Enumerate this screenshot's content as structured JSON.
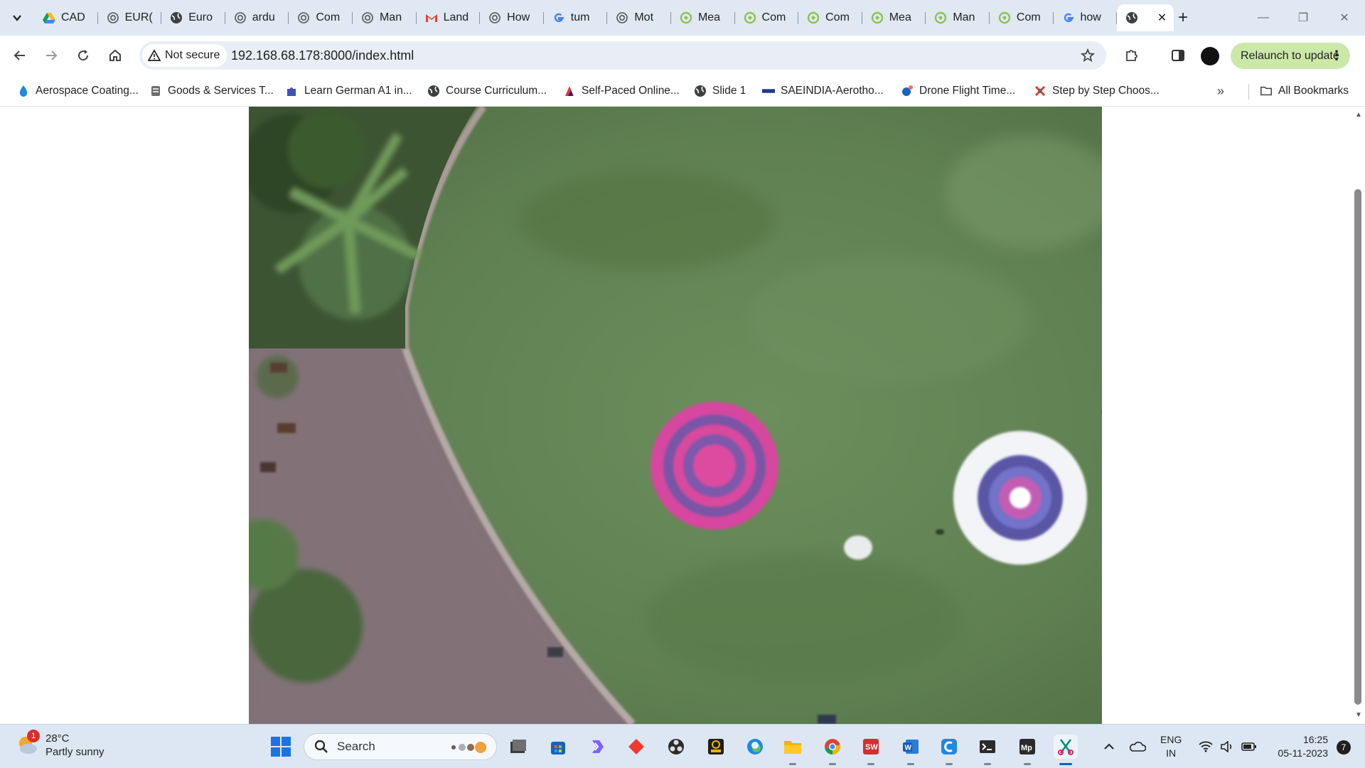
{
  "browser": {
    "tabs": [
      {
        "title": "CAD",
        "icon": "google-drive-icon"
      },
      {
        "title": "EUR(",
        "icon": "openai-icon"
      },
      {
        "title": "Euro",
        "icon": "globe-icon"
      },
      {
        "title": "ardu",
        "icon": "openai-icon"
      },
      {
        "title": "Com",
        "icon": "openai-icon"
      },
      {
        "title": "Man",
        "icon": "openai-icon"
      },
      {
        "title": "Land",
        "icon": "gmail-icon"
      },
      {
        "title": "How",
        "icon": "openai-icon"
      },
      {
        "title": "tum",
        "icon": "google-icon"
      },
      {
        "title": "Mot",
        "icon": "openai-icon"
      },
      {
        "title": "Mea",
        "icon": "lime-circle-icon"
      },
      {
        "title": "Com",
        "icon": "lime-circle-icon"
      },
      {
        "title": "Com",
        "icon": "lime-circle-icon"
      },
      {
        "title": "Mea",
        "icon": "lime-circle-icon"
      },
      {
        "title": "Man",
        "icon": "lime-circle-icon"
      },
      {
        "title": "Com",
        "icon": "lime-circle-icon"
      },
      {
        "title": "how",
        "icon": "google-icon"
      }
    ],
    "active_tab": {
      "icon": "globe-icon",
      "close": "✕"
    },
    "new_tab": "+",
    "window_controls": {
      "minimize": "—",
      "maximize": "❐",
      "close": "✕"
    }
  },
  "toolbar": {
    "security_label": "Not secure",
    "url": "192.168.68.178:8000/index.html",
    "relaunch_label": "Relaunch to update"
  },
  "bookmarks": {
    "items": [
      {
        "label": "Aerospace Coating...",
        "icon": "droplet-icon"
      },
      {
        "label": "Goods & Services T...",
        "icon": "emblem-icon"
      },
      {
        "label": "Learn German A1 in...",
        "icon": "puzzle-icon"
      },
      {
        "label": "Course Curriculum...",
        "icon": "globe-icon"
      },
      {
        "label": "Self-Paced Online...",
        "icon": "flame-icon"
      },
      {
        "label": "Slide 1",
        "icon": "globe-icon"
      },
      {
        "label": "SAEINDIA-Aerotho...",
        "icon": "sae-icon"
      },
      {
        "label": "Drone Flight Time...",
        "icon": "drone-icon"
      },
      {
        "label": "Step by Step Choos...",
        "icon": "quad-icon"
      }
    ],
    "more": "»",
    "all_bookmarks": "All Bookmarks"
  },
  "page": {
    "image_description_name": "aerial-drone-photo"
  },
  "taskbar": {
    "weather": {
      "temp": "28°C",
      "condition": "Partly sunny",
      "badge": "1"
    },
    "search_placeholder": "Search",
    "apps": [
      "file-explorer-icon",
      "store-icon",
      "copilot-icon",
      "anydesk-icon",
      "obs-icon",
      "wb-icon",
      "edge-icon",
      "folder-icon",
      "chrome-icon",
      "solidworks-icon",
      "word-icon",
      "c-app-icon",
      "terminal-icon",
      "mp-icon",
      "snipping-tool-icon"
    ],
    "lang_top": "ENG",
    "lang_bottom": "IN",
    "time": "16:25",
    "date": "05-11-2023",
    "notification_count": "7"
  }
}
